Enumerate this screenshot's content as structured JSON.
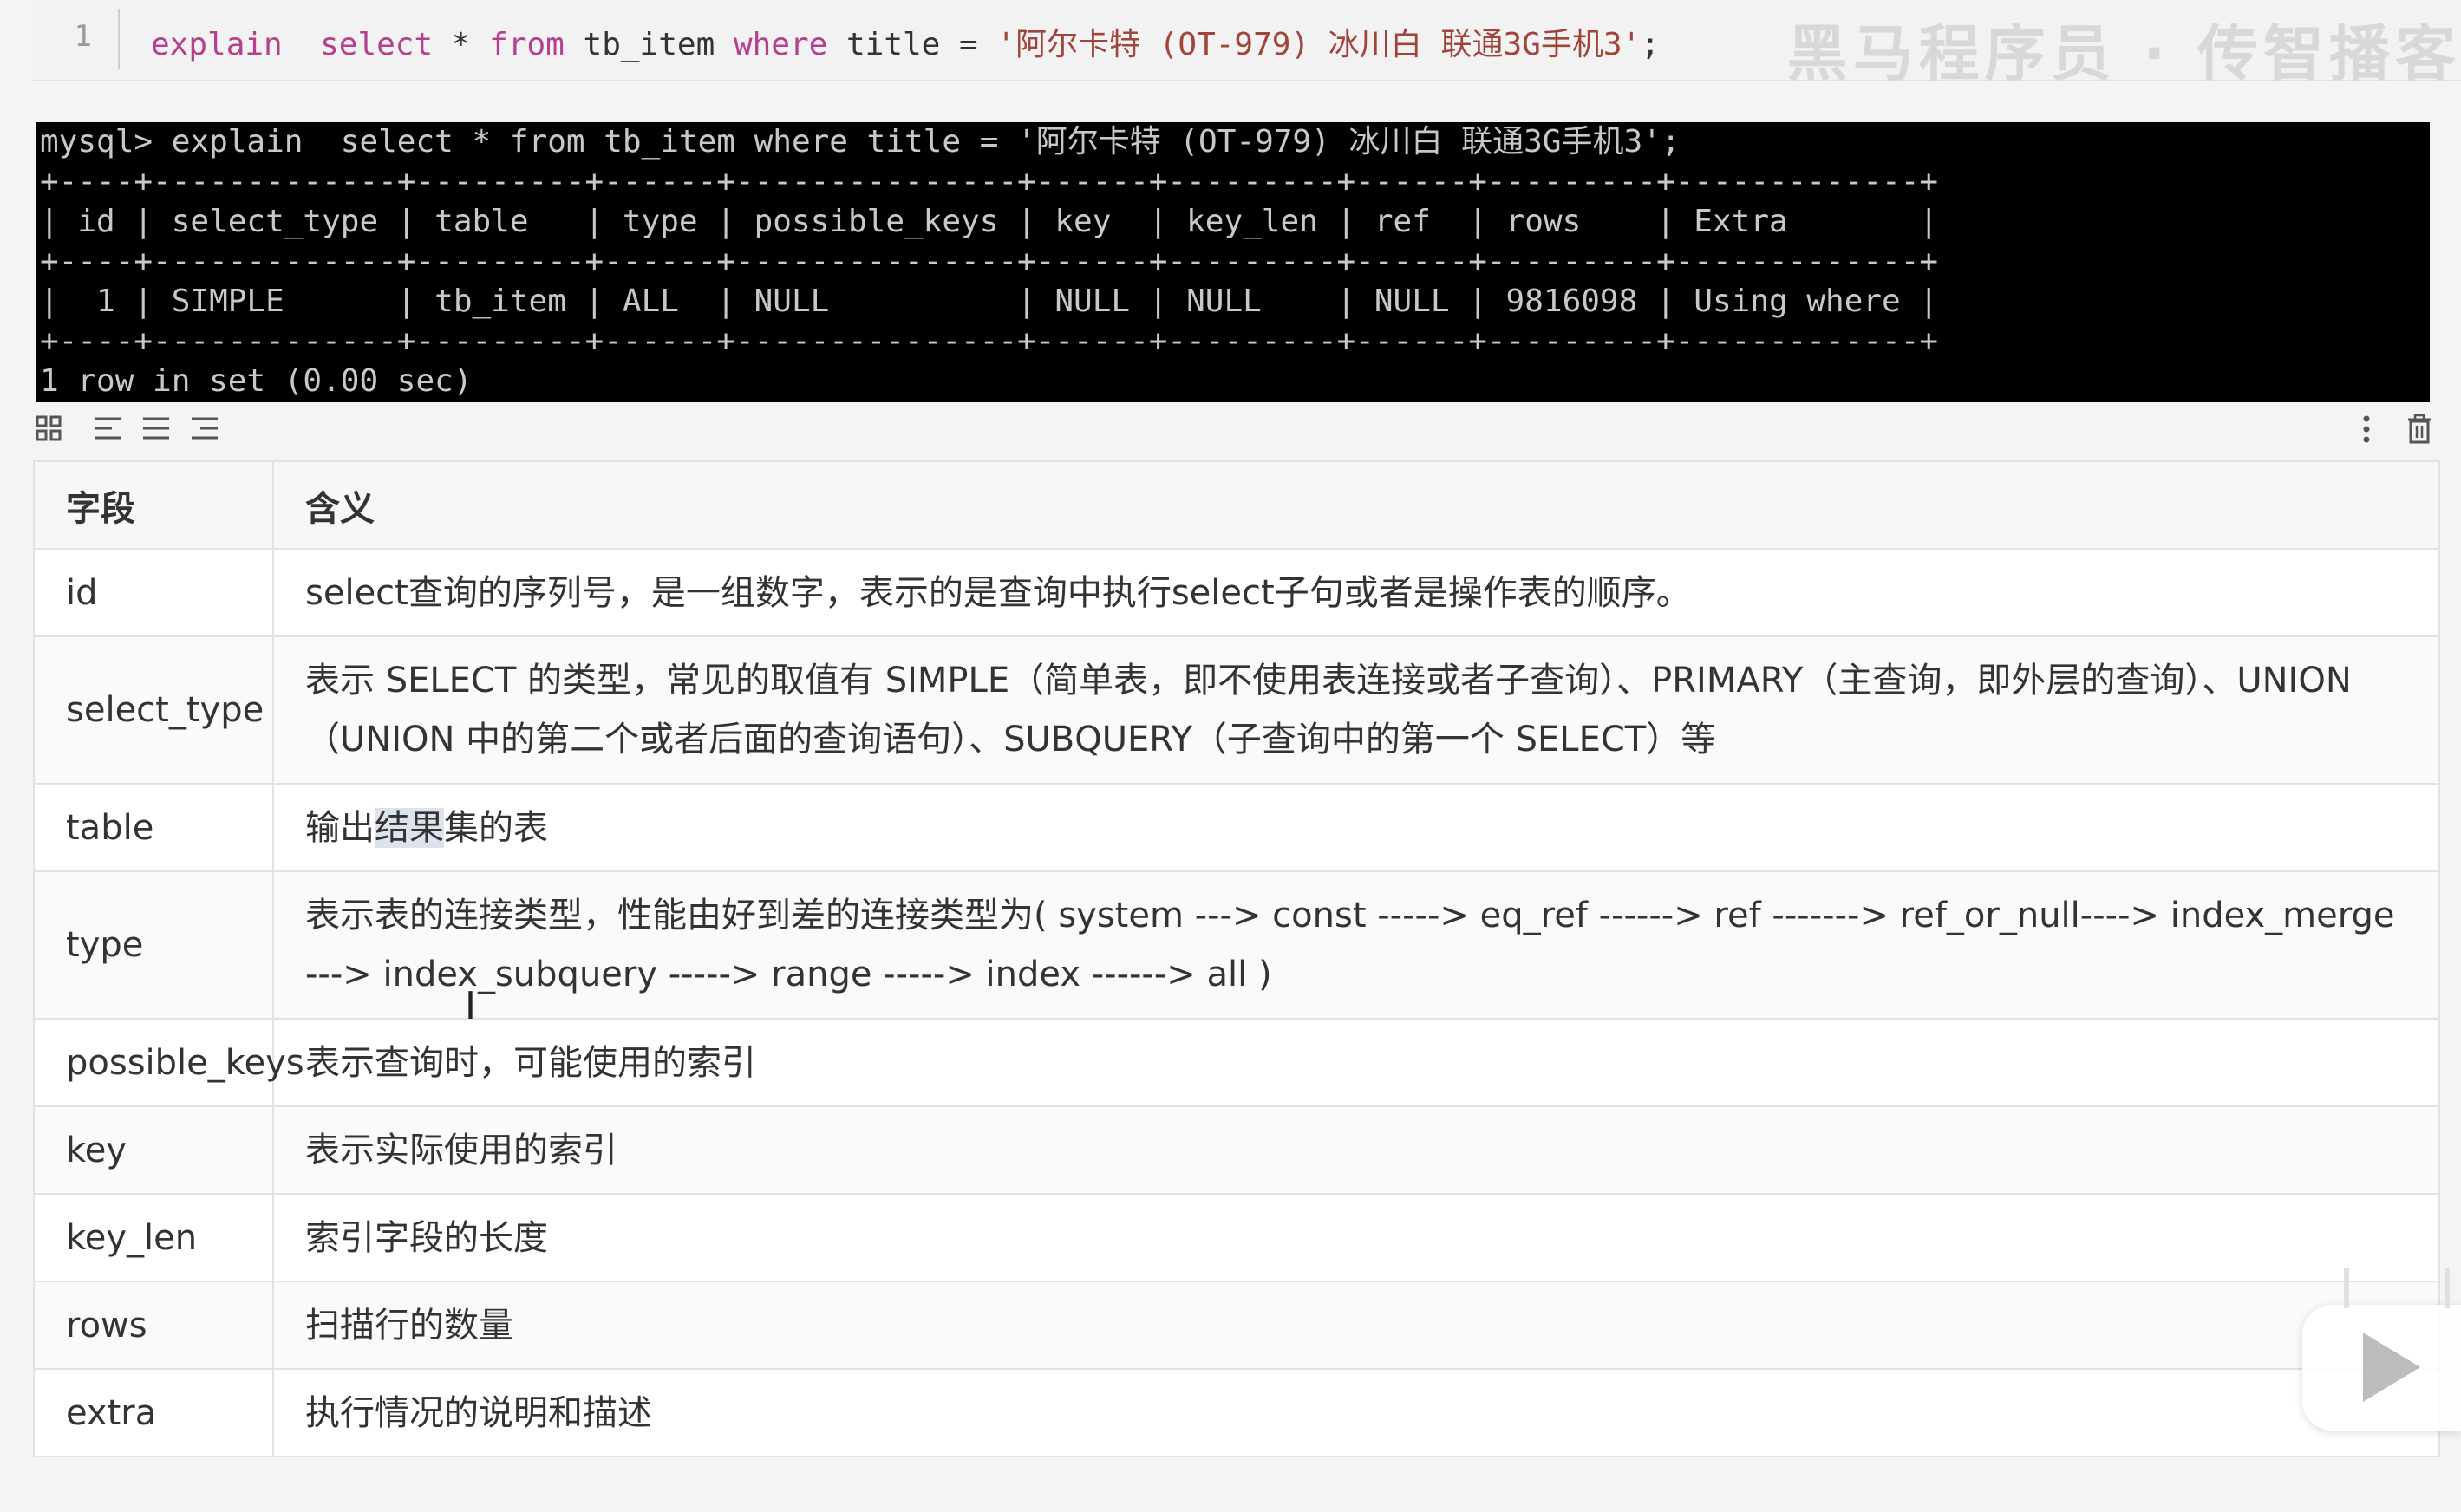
{
  "editor": {
    "line_number": "1",
    "code_keyword_1": "explain",
    "code_keyword_2": "select",
    "code_rest_1": " * ",
    "code_keyword_3": "from",
    "code_rest_2": " tb_item ",
    "code_keyword_4": "where",
    "code_rest_3": " title = ",
    "code_string": "'阿尔卡特 (OT-979) 冰川白 联通3G手机3'",
    "code_end": ";",
    "watermark": "黑马程序员 · 传智播客"
  },
  "terminal": {
    "text": "mysql> explain  select * from tb_item where title = '阿尔卡特 (OT-979) 冰川白 联通3G手机3';\n+----+-------------+---------+------+---------------+------+---------+------+---------+-------------+\n| id | select_type | table   | type | possible_keys | key  | key_len | ref  | rows    | Extra       |\n+----+-------------+---------+------+---------------+------+---------+------+---------+-------------+\n|  1 | SIMPLE      | tb_item | ALL  | NULL          | NULL | NULL    | NULL | 9816098 | Using where |\n+----+-------------+---------+------+---------------+------+---------+------+---------+-------------+\n1 row in set (0.00 sec)"
  },
  "toolbar": {
    "icons": [
      "grid-icon",
      "align-left-icon",
      "align-center-icon",
      "align-right-icon"
    ],
    "right_icons": [
      "more-vertical-icon",
      "trash-icon"
    ]
  },
  "table": {
    "headers": [
      "字段",
      "含义"
    ],
    "rows": [
      {
        "field": "id",
        "meaning": "select查询的序列号，是一组数字，表示的是查询中执行select子句或者是操作表的顺序。"
      },
      {
        "field": "select_type",
        "meaning": "表示 SELECT 的类型，常见的取值有 SIMPLE（简单表，即不使用表连接或者子查询）、PRIMARY（主查询，即外层的查询）、UNION（UNION 中的第二个或者后面的查询语句）、SUBQUERY（子查询中的第一个 SELECT）等"
      },
      {
        "field": "table",
        "meaning_pre": "输出",
        "meaning_hl": "结果",
        "meaning_post": "集的表"
      },
      {
        "field": "type",
        "meaning": "表示表的连接类型，性能由好到差的连接类型为( system  ---> const  -----> eq_ref  ------> ref  -------> ref_or_null----> index_merge ---> index_subquery -----> range -----> index ------> all )"
      },
      {
        "field": "possible_keys",
        "meaning": "表示查询时，可能使用的索引"
      },
      {
        "field": "key",
        "meaning": "表示实际使用的索引"
      },
      {
        "field": "key_len",
        "meaning": "索引字段的长度"
      },
      {
        "field": "rows",
        "meaning": "扫描行的数量"
      },
      {
        "field": "extra",
        "meaning": "执行情况的说明和描述"
      }
    ]
  }
}
